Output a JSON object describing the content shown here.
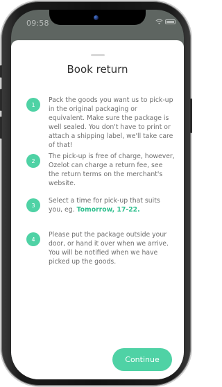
{
  "status": {
    "time": "09:58"
  },
  "sheet": {
    "title": "Book return",
    "steps": [
      {
        "num": "1",
        "text": "Pack the goods you want us to pick-up in the original packaging or equivalent. Make sure the package is well sealed. You don't have to print or attach a shipping label, we'll take care of that!"
      },
      {
        "num": "2",
        "text": "The pick-up is free of charge, however, Ozelot can charge a return fee, see the return terms on the merchant's website."
      },
      {
        "num": "3",
        "text_before": "Select a time for pick-up that suits you, eg. ",
        "highlight": "Tomorrow, 17-22."
      },
      {
        "num": "4",
        "text": "Please put the package outside your door, or hand it over when we arrive. You will be notified when we have picked up the goods."
      }
    ],
    "continue_label": "Continue"
  },
  "colors": {
    "accent": "#4fd2a5",
    "highlight_text": "#2fbf8e",
    "overlay": "#5e6561"
  }
}
